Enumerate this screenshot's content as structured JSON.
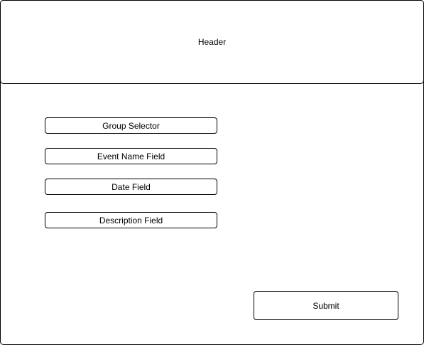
{
  "header": {
    "title": "Header"
  },
  "form": {
    "group_selector": "Group Selector",
    "event_name_field": "Event Name Field",
    "date_field": "Date Field",
    "description_field": "Description Field",
    "submit_label": "Submit"
  }
}
